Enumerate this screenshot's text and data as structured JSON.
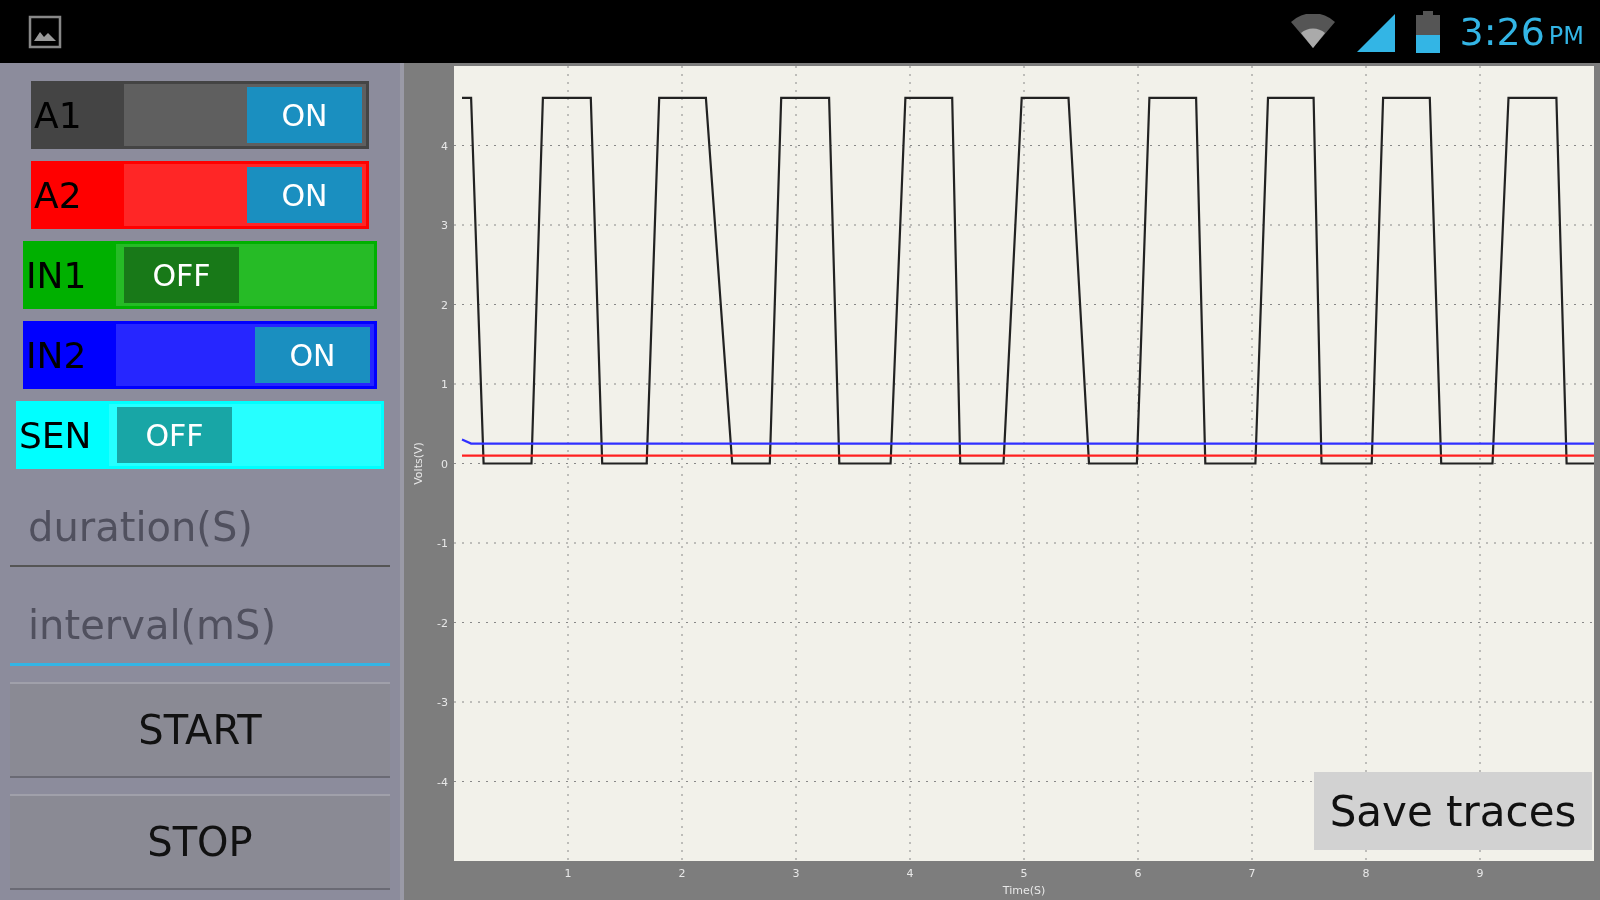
{
  "status_bar": {
    "time": "3:26",
    "period": "PM"
  },
  "channels": [
    {
      "label": "A1",
      "color": "#444444",
      "on": true,
      "thumb": "ON"
    },
    {
      "label": "A2",
      "color": "#ff0000",
      "on": true,
      "thumb": "ON"
    },
    {
      "label": "IN1",
      "color": "#00b000",
      "on": false,
      "thumb": "OFF"
    },
    {
      "label": "IN2",
      "color": "#0000ff",
      "on": true,
      "thumb": "ON"
    },
    {
      "label": "SEN",
      "color": "#00ffff",
      "on": false,
      "thumb": "OFF"
    }
  ],
  "fields": [
    {
      "placeholder": "duration(S)",
      "focused": false
    },
    {
      "placeholder": "interval(mS)",
      "focused": true
    }
  ],
  "buttons": [
    "START",
    "STOP"
  ],
  "chart": {
    "save_button": "Save traces",
    "chart_data": {
      "type": "line",
      "grid": true,
      "xlabel": "Time(S)",
      "ylabel": "Volts(V)",
      "xlim": [
        0,
        10
      ],
      "ylim": [
        -5,
        5
      ],
      "xticks": [
        1,
        2,
        3,
        4,
        5,
        6,
        7,
        8,
        9
      ],
      "yticks": [
        -4,
        -3,
        -2,
        -1,
        0,
        1,
        2,
        3,
        4
      ],
      "x": [
        0.07,
        0.15,
        0.26,
        0.68,
        0.78,
        1.2,
        1.3,
        1.69,
        1.8,
        2.21,
        2.44,
        2.77,
        2.87,
        3.29,
        3.38,
        3.83,
        3.96,
        4.37,
        4.44,
        4.82,
        4.98,
        5.39,
        5.57,
        5.99,
        6.1,
        6.51,
        6.59,
        7.03,
        7.14,
        7.54,
        7.61,
        8.05,
        8.15,
        8.56,
        8.66,
        9.11,
        9.25,
        9.67,
        9.76,
        10
      ],
      "series": [
        {
          "color": "#222222",
          "values": [
            4.6,
            4.6,
            0,
            0,
            4.6,
            4.6,
            0,
            0,
            4.6,
            4.6,
            0,
            0,
            4.6,
            4.6,
            0,
            0,
            4.6,
            4.6,
            0,
            0,
            4.6,
            4.6,
            0,
            0,
            4.6,
            4.6,
            0,
            0,
            4.6,
            4.6,
            0,
            0,
            4.6,
            4.6,
            0,
            0,
            4.6,
            4.6,
            0,
            0
          ]
        },
        {
          "color": "#3030ff",
          "values": [
            0.3,
            0.25,
            0.25,
            0.25,
            0.25,
            0.25,
            0.25,
            0.25,
            0.25,
            0.25,
            0.25,
            0.25,
            0.25,
            0.25,
            0.25,
            0.25,
            0.25,
            0.25,
            0.25,
            0.25,
            0.25,
            0.25,
            0.25,
            0.25,
            0.25,
            0.25,
            0.25,
            0.25,
            0.25,
            0.25,
            0.25,
            0.25,
            0.25,
            0.25,
            0.25,
            0.25,
            0.25,
            0.25,
            0.25,
            0.25
          ]
        },
        {
          "color": "#ff2020",
          "values": [
            0.1,
            0.1,
            0.1,
            0.1,
            0.1,
            0.1,
            0.1,
            0.1,
            0.1,
            0.1,
            0.1,
            0.1,
            0.1,
            0.1,
            0.1,
            0.1,
            0.1,
            0.1,
            0.1,
            0.1,
            0.1,
            0.1,
            0.1,
            0.1,
            0.1,
            0.1,
            0.1,
            0.1,
            0.1,
            0.1,
            0.1,
            0.1,
            0.1,
            0.1,
            0.1,
            0.1,
            0.1,
            0.1,
            0.1,
            0.1
          ]
        }
      ]
    }
  }
}
